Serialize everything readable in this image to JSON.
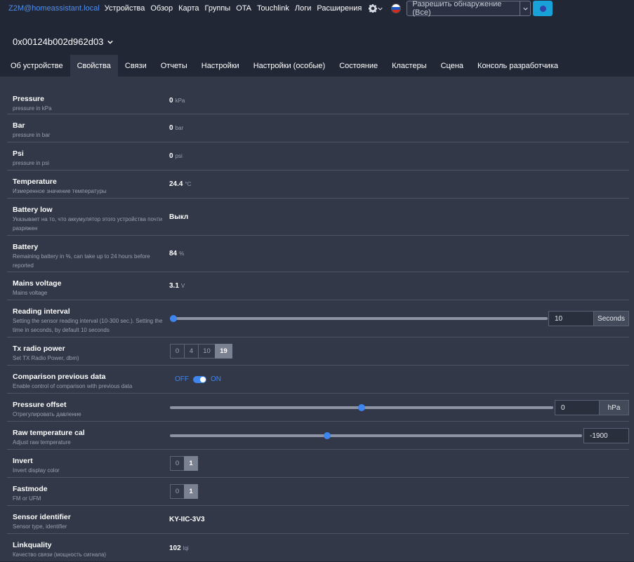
{
  "nav": {
    "brand": "Z2M@homeassistant.local",
    "links": [
      "Устройства",
      "Обзор",
      "Карта",
      "Группы",
      "OTA",
      "Touchlink",
      "Логи",
      "Расширения"
    ],
    "permit_label": "Разрешить обнаружение (Все)"
  },
  "device": {
    "name": "0x00124b002d962d03"
  },
  "tabs": [
    "Об устройстве",
    "Свойства",
    "Связи",
    "Отчеты",
    "Настройки",
    "Настройки (особые)",
    "Состояние",
    "Кластеры",
    "Сцена",
    "Консоль разработчика"
  ],
  "active_tab": "Свойства",
  "rows": {
    "pressure": {
      "title": "Pressure",
      "desc": "pressure in kPa",
      "value": "0",
      "unit": "kPa"
    },
    "bar": {
      "title": "Bar",
      "desc": "pressure in bar",
      "value": "0",
      "unit": "bar"
    },
    "psi": {
      "title": "Psi",
      "desc": "pressure in psi",
      "value": "0",
      "unit": "psi"
    },
    "temperature": {
      "title": "Temperature",
      "desc": "Измеренное значение температуры",
      "value": "24.4",
      "unit": "°C"
    },
    "battery_low": {
      "title": "Battery low",
      "desc": "Указывает на то, что аккумулятор этого устройства почти разряжен",
      "value": "Выкл"
    },
    "battery": {
      "title": "Battery",
      "desc": "Remaining battery in %, can take up to 24 hours before reported",
      "value": "84",
      "unit": "%"
    },
    "mains_voltage": {
      "title": "Mains voltage",
      "desc": "Mains voltage",
      "value": "3.1",
      "unit": "V"
    },
    "reading_interval": {
      "title": "Reading interval",
      "desc": "Setting the sensor reading interval (10-300 sec.). Setting the time in seconds, by default 10 seconds",
      "value": "10",
      "unit": "Seconds",
      "level": 0
    },
    "tx_radio_power": {
      "title": "Tx radio power",
      "desc": "Set TX Radio Power, dbm)",
      "options": [
        "0",
        "4",
        "10",
        "19"
      ],
      "selected": "19"
    },
    "comparison": {
      "title": "Comparison previous data",
      "desc": "Enable control of comparison with previous data",
      "off_label": "OFF",
      "on_label": "ON",
      "state": "ON"
    },
    "pressure_offset": {
      "title": "Pressure offset",
      "desc": "Отрегулировать давление",
      "value": "0",
      "unit": "hPa",
      "level": 0.5
    },
    "raw_temp_cal": {
      "title": "Raw temperature cal",
      "desc": "Adjust raw temperature",
      "value": "-1900",
      "level": 0.38
    },
    "invert": {
      "title": "Invert",
      "desc": "Invert display color",
      "options": [
        "0",
        "1"
      ],
      "selected": "1"
    },
    "fastmode": {
      "title": "Fastmode",
      "desc": "FM or UFM",
      "options": [
        "0",
        "1"
      ],
      "selected": "1"
    },
    "sensor_identifier": {
      "title": "Sensor identifier",
      "desc": "Sensor type, identifier",
      "value": "KY-IIC-3V3"
    },
    "linkquality": {
      "title": "Linkquality",
      "desc": "Качество связи (мощность сигнала)",
      "value": "102",
      "unit": "lqi"
    }
  },
  "colors": {
    "accent": "#3d86f0",
    "brand": "#4f8ff0",
    "permit_button": "#19a2d8",
    "panel": "#323848",
    "background": "#222736"
  }
}
